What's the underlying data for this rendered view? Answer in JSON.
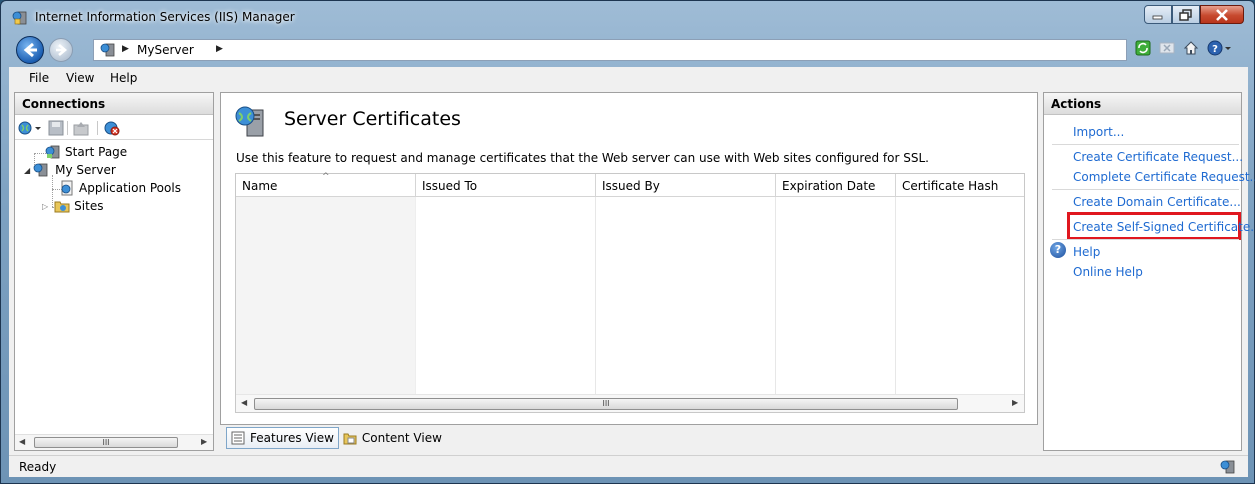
{
  "window": {
    "title": "Internet Information Services (IIS) Manager"
  },
  "navigation": {
    "breadcrumb": "MyServer"
  },
  "menu": [
    "File",
    "View",
    "Help"
  ],
  "connections": {
    "title": "Connections",
    "tree": {
      "start_page": "Start Page",
      "server": "My Server",
      "app_pools": "Application Pools",
      "sites": "Sites"
    },
    "scroll_mark": "III"
  },
  "feature": {
    "title": "Server Certificates",
    "description": "Use this feature to request and manage certificates that the Web server can use with Web sites configured for SSL.",
    "columns": [
      "Name",
      "Issued To",
      "Issued By",
      "Expiration Date",
      "Certificate Hash"
    ],
    "rows": [],
    "scroll_mark": "III"
  },
  "views": {
    "features": "Features View",
    "content": "Content View"
  },
  "actions": {
    "title": "Actions",
    "import": "Import...",
    "create_request": "Create Certificate Request...",
    "complete_request": "Complete Certificate Request...",
    "create_domain": "Create Domain Certificate...",
    "create_self_signed": "Create Self-Signed Certificate...",
    "help": "Help",
    "online_help": "Online Help"
  },
  "status": {
    "text": "Ready"
  },
  "colors": {
    "link": "#1e6ad1",
    "highlight": "#e0171f",
    "frame": "#7ea2c2"
  }
}
